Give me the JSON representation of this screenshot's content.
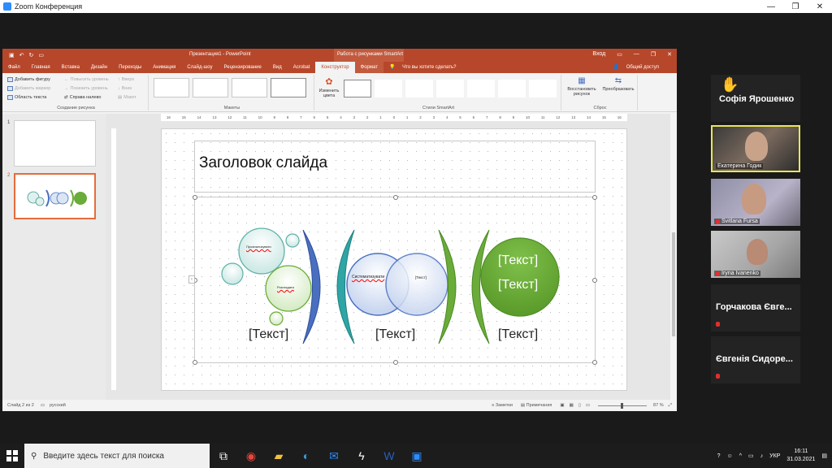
{
  "zoom": {
    "window_title": "Zoom Конференция",
    "controls": [
      "—",
      "❐",
      "✕"
    ]
  },
  "ppt": {
    "doc_title": "Презентация1 - PowerPoint",
    "context_title": "Работа с рисунками SmartArt",
    "title_right": [
      "Вход",
      "▭",
      "—",
      "❐",
      "✕"
    ],
    "tabs": [
      "Файл",
      "Главная",
      "Вставка",
      "Дизайн",
      "Переходы",
      "Анимация",
      "Слайд-шоу",
      "Рецензирование",
      "Вид",
      "Acrobat"
    ],
    "tab_konstruktor": "Конструктор",
    "tab_format": "Формат",
    "tell_me": "Что вы хотите сделать?",
    "share": "Общий доступ",
    "ribbon": {
      "add_shape": "Добавить фигуру",
      "add_bullet": "Добавить маркер",
      "text_pane": "Область текста",
      "promote": "Повысить уровень",
      "demote": "Понизить уровень",
      "rtl": "Справа налево",
      "up": "Вверх",
      "down": "Вниз",
      "layout_btn": "Макет",
      "group_create": "Создание рисунка",
      "group_layouts": "Макеты",
      "change_colors": "Изменить цвета",
      "group_styles": "Стили SmartArt",
      "reset_graphic": "Восстановить рисунок",
      "convert": "Преобразовать",
      "group_reset": "Сброс"
    },
    "ruler_ticks": [
      "16",
      "15",
      "14",
      "13",
      "12",
      "11",
      "10",
      "9",
      "8",
      "7",
      "6",
      "5",
      "4",
      "3",
      "2",
      "1",
      "0",
      "1",
      "2",
      "3",
      "4",
      "5",
      "6",
      "7",
      "8",
      "9",
      "10",
      "11",
      "12",
      "13",
      "14",
      "15",
      "16"
    ],
    "slide_numbers": [
      "1",
      "2"
    ],
    "slide": {
      "title": "Заголовок слайда",
      "labels": {
        "small1": "Проанализувати",
        "small2": "Розглядати",
        "mid1": "Систематизувати",
        "mid2": "[Текст]",
        "big1": "[Текст]",
        "big2": "[Текст]",
        "bottom1": "[Текст]",
        "bottom2": "[Текст]",
        "bottom3": "[Текст]"
      }
    },
    "status": {
      "slide_info": "Слайд 2 из 2",
      "language": "русский",
      "notes": "Заметки",
      "comments": "Примечания",
      "zoom": "87 %"
    }
  },
  "participants": [
    {
      "name": "Софія Ярошенко",
      "type": "name",
      "hand": true
    },
    {
      "name": "Екатерина Годик",
      "type": "video",
      "active": true
    },
    {
      "name": "Svitlana Fursa",
      "type": "video"
    },
    {
      "name": "Iryna Ivanenko",
      "type": "video"
    },
    {
      "name": "Горчакова Євге...",
      "type": "name"
    },
    {
      "name": "Євгенія Сидоре...",
      "type": "name"
    }
  ],
  "taskbar": {
    "search_placeholder": "Введите здесь текст для поиска",
    "language": "УКР",
    "time": "16:11",
    "date": "31.03.2021"
  },
  "colors": {
    "ppt_accent": "#b7472a",
    "smartart_blue": "#4a6fc0",
    "smartart_teal": "#2fa5a5",
    "smartart_green": "#6aab3a"
  }
}
